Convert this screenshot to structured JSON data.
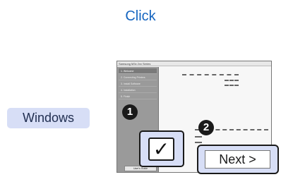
{
  "header": {
    "title": "Click"
  },
  "os_label": "Windows",
  "screenshot": {
    "window_title": "Samsung M3x 2xx Series",
    "sidebar_items": [
      "1. Welcome",
      "2. Connecting Printers",
      "3. Install Software",
      "4. Installation",
      "5. Finish"
    ],
    "sidebar_button_label": "User's Guide"
  },
  "callouts": {
    "step1": "1",
    "step2": "2",
    "check_glyph": "✓",
    "next_label": "Next >"
  },
  "colors": {
    "title_blue": "#1565c0",
    "highlight_fill": "#d7def6",
    "callout_dark": "#1a1a1a"
  },
  "icons": {
    "checkbox": "check-icon",
    "steps": "numbered-circle-icon"
  }
}
